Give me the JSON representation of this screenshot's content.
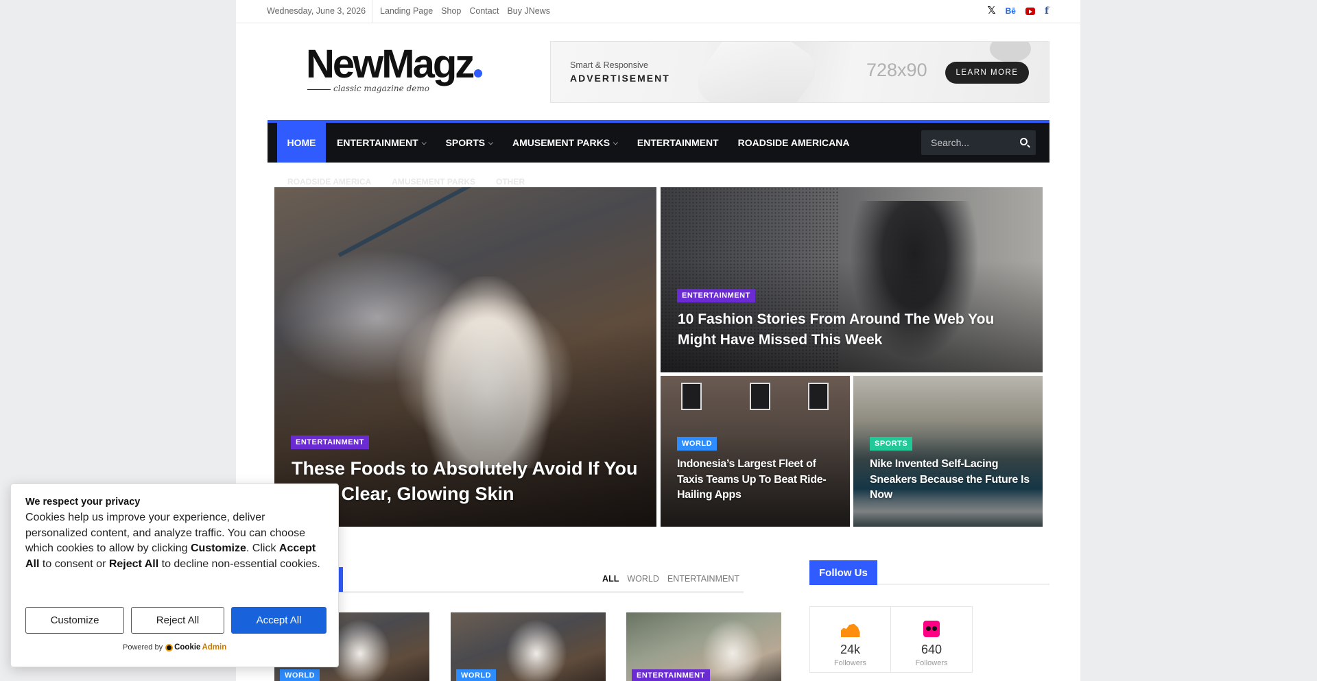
{
  "topbar": {
    "date": "Wednesday, June 3, 2026",
    "links": [
      "Landing Page",
      "Shop",
      "Contact",
      "Buy JNews"
    ],
    "social": [
      {
        "name": "x-icon",
        "glyph": "𝕏"
      },
      {
        "name": "behance-icon",
        "glyph": "Bē"
      },
      {
        "name": "youtube-icon",
        "glyph": ""
      },
      {
        "name": "facebook-icon",
        "glyph": "f"
      }
    ]
  },
  "logo": {
    "name": "NewMagz",
    "tagline": "classic magazine demo",
    "dot_color": "#2f5bff"
  },
  "ad": {
    "small": "Smart & Responsive",
    "big": "ADVERTISEMENT",
    "dims": "728x90",
    "button": "LEARN MORE"
  },
  "nav": {
    "home": "HOME",
    "items": [
      {
        "label": "ENTERTAINMENT",
        "dropdown": true
      },
      {
        "label": "SPORTS",
        "dropdown": true
      },
      {
        "label": "AMUSEMENT PARKS",
        "dropdown": true
      },
      {
        "label": "ENTERTAINMENT",
        "dropdown": false
      },
      {
        "label": "ROADSIDE AMERICANA",
        "dropdown": false
      }
    ],
    "search_placeholder": "Search...",
    "accent": "#2f5bff",
    "ghost_items": [
      "ROADSIDE AMERICA",
      "AMUSEMENT PARKS",
      "OTHER"
    ]
  },
  "hero": [
    {
      "category": "ENTERTAINMENT",
      "title": "These Foods to Absolutely Avoid If You Want Clear, Glowing Skin"
    },
    {
      "category": "ENTERTAINMENT",
      "title": "10 Fashion Stories From Around The Web You Might Have Missed This Week"
    },
    {
      "category": "WORLD",
      "title": "Indonesia’s Largest Fleet of Taxis Teams Up To Beat Ride-Hailing Apps"
    },
    {
      "category": "SPORTS",
      "title": "Nike Invented Self-Lacing Sneakers Because the Future Is Now"
    }
  ],
  "block": {
    "filters": [
      "ALL",
      "WORLD",
      "ENTERTAINMENT"
    ],
    "thumbs": [
      {
        "category": "WORLD"
      },
      {
        "category": "WORLD"
      },
      {
        "category": "ENTERTAINMENT"
      }
    ]
  },
  "sidebar": {
    "follow_label": "Follow Us",
    "counters": [
      {
        "icon": "soundcloud-icon",
        "count": "24k",
        "label": "Followers"
      },
      {
        "icon": "flickr-icon",
        "count": "640",
        "label": "Followers"
      }
    ]
  },
  "cookie": {
    "title": "We respect your privacy",
    "text_1": "Cookies help us improve your experience, deliver personalized content, and analyze traffic. You can choose which cookies to allow by clicking ",
    "bold_1": "Customize",
    "text_2": ". Click ",
    "bold_2": "Accept All",
    "text_3": " to consent or ",
    "bold_3": "Reject All",
    "text_4": " to decline non-essential cookies.",
    "customize": "Customize",
    "reject": "Reject All",
    "accept": "Accept All",
    "powered_by": "Powered by",
    "brand_cookie": "Cookie",
    "brand_admin": "Admin"
  }
}
